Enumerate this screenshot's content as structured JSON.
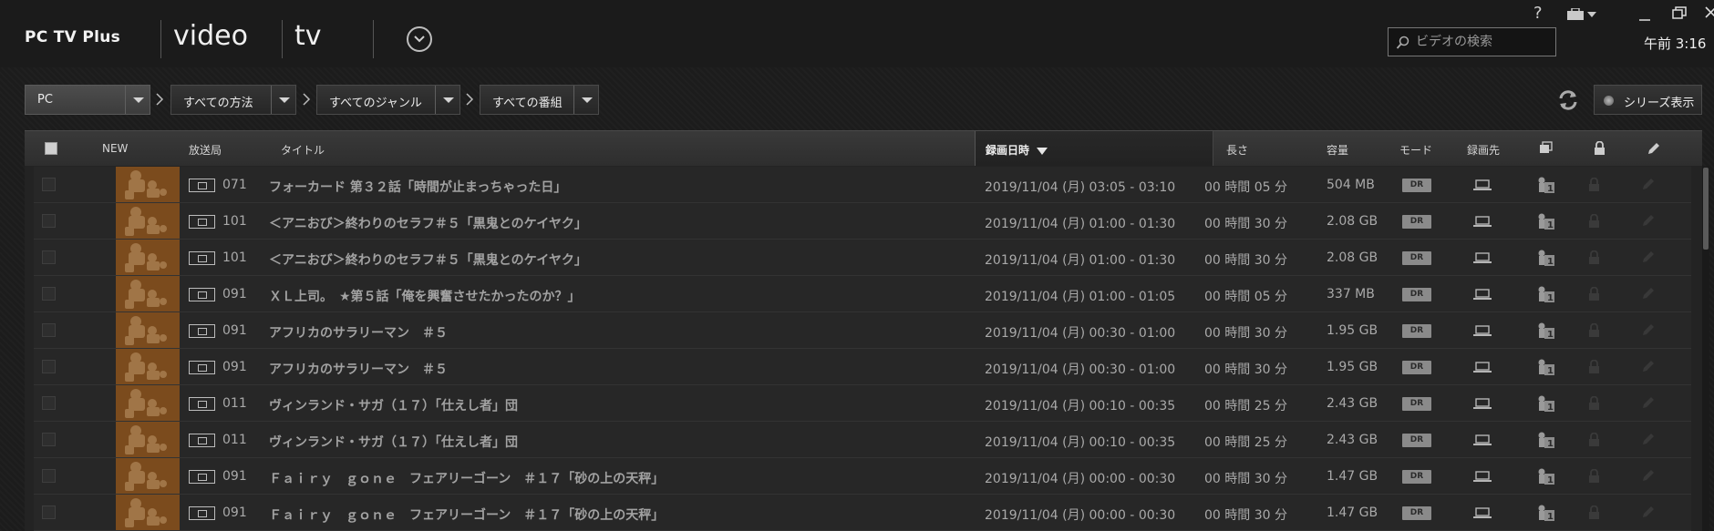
{
  "app": {
    "title": "PC TV Plus"
  },
  "nav": {
    "tabs": [
      {
        "label": "video"
      },
      {
        "label": "tv"
      }
    ]
  },
  "window": {
    "help": "?",
    "clock": "午前 3:16"
  },
  "search": {
    "placeholder": "ビデオの検索",
    "value": ""
  },
  "filters": [
    {
      "label": "PC"
    },
    {
      "label": "すべての方法"
    },
    {
      "label": "すべてのジャンル"
    },
    {
      "label": "すべての番組"
    }
  ],
  "series_button": {
    "label": "シリーズ表示"
  },
  "table": {
    "headers": {
      "new": "NEW",
      "station": "放送局",
      "title": "タイトル",
      "date": "録画日時",
      "length": "長さ",
      "size": "容量",
      "mode": "モード",
      "dest": "録画先"
    },
    "rows": [
      {
        "ch": "071",
        "title": "フォーカード 第３２話「時間が止まっちゃった日」",
        "date": "2019/11/04 (月) 03:05 - 03:10",
        "length": "00 時間 05 分",
        "size": "504 MB",
        "mode": "DR"
      },
      {
        "ch": "101",
        "title": "＜アニおび＞終わりのセラフ＃５「黒鬼とのケイヤク」",
        "date": "2019/11/04 (月) 01:00 - 01:30",
        "length": "00 時間 30 分",
        "size": "2.08 GB",
        "mode": "DR"
      },
      {
        "ch": "101",
        "title": "＜アニおび＞終わりのセラフ＃５「黒鬼とのケイヤク」",
        "date": "2019/11/04 (月) 01:00 - 01:30",
        "length": "00 時間 30 分",
        "size": "2.08 GB",
        "mode": "DR"
      },
      {
        "ch": "091",
        "title": "ＸＬ上司。　★第５話「俺を興奮させたかったのか？」",
        "date": "2019/11/04 (月) 01:00 - 01:05",
        "length": "00 時間 05 分",
        "size": "337 MB",
        "mode": "DR"
      },
      {
        "ch": "091",
        "title": "アフリカのサラリーマン　＃５",
        "date": "2019/11/04 (月) 00:30 - 01:00",
        "length": "00 時間 30 分",
        "size": "1.95 GB",
        "mode": "DR"
      },
      {
        "ch": "091",
        "title": "アフリカのサラリーマン　＃５",
        "date": "2019/11/04 (月) 00:30 - 01:00",
        "length": "00 時間 30 分",
        "size": "1.95 GB",
        "mode": "DR"
      },
      {
        "ch": "011",
        "title": "ヴィンランド・サガ（１７）「仕えし者」団",
        "date": "2019/11/04 (月) 00:10 - 00:35",
        "length": "00 時間 25 分",
        "size": "2.43 GB",
        "mode": "DR"
      },
      {
        "ch": "011",
        "title": "ヴィンランド・サガ（１７）「仕えし者」団",
        "date": "2019/11/04 (月) 00:10 - 00:35",
        "length": "00 時間 25 分",
        "size": "2.43 GB",
        "mode": "DR"
      },
      {
        "ch": "091",
        "title": "Ｆａｉｒｙ　ｇｏｎｅ　フェアリーゴーン　＃１７「砂の上の天秤」",
        "date": "2019/11/04 (月) 00:00 - 00:30",
        "length": "00 時間 30 分",
        "size": "1.47 GB",
        "mode": "DR"
      },
      {
        "ch": "091",
        "title": "Ｆａｉｒｙ　ｇｏｎｅ　フェアリーゴーン　＃１７「砂の上の天秤」",
        "date": "2019/11/04 (月) 00:00 - 00:30",
        "length": "00 時間 30 分",
        "size": "1.47 GB",
        "mode": "DR"
      }
    ]
  },
  "icons": {
    "window": [
      "help-icon",
      "toolbox-icon",
      "minimize-icon",
      "restore-icon",
      "close-icon"
    ],
    "columns": [
      "copy-icon",
      "lock-icon",
      "edit-icon"
    ],
    "row": [
      "laptop-icon",
      "copy-count-icon",
      "lock-icon",
      "edit-icon"
    ]
  },
  "colors": {
    "background": "#1c1c1c",
    "header": "#353535",
    "row": "#272727",
    "thumbnail": "#7a4a1c",
    "badge": "#8a8a8a"
  }
}
